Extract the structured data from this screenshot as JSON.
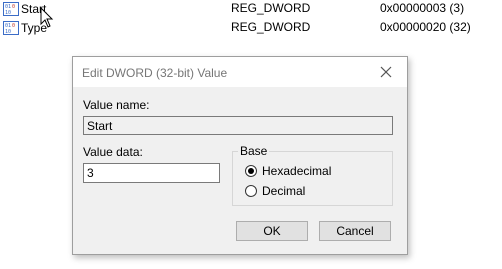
{
  "registry_values": [
    {
      "name": "Start",
      "type": "REG_DWORD",
      "data": "0x00000003 (3)"
    },
    {
      "name": "Type",
      "type": "REG_DWORD",
      "data": "0x00000020 (32)"
    }
  ],
  "dialog": {
    "title": "Edit DWORD (32-bit) Value",
    "value_name_label": "Value name:",
    "value_name": "Start",
    "value_data_label": "Value data:",
    "value_data": "3",
    "base_label": "Base",
    "base_options": [
      {
        "label": "Hexadecimal",
        "selected": true
      },
      {
        "label": "Decimal",
        "selected": false
      }
    ],
    "ok_label": "OK",
    "cancel_label": "Cancel"
  },
  "colors": {
    "dialog_background": "#f0f0f0",
    "title_text": "#767676",
    "icon_blue": "#3b6cc7"
  }
}
